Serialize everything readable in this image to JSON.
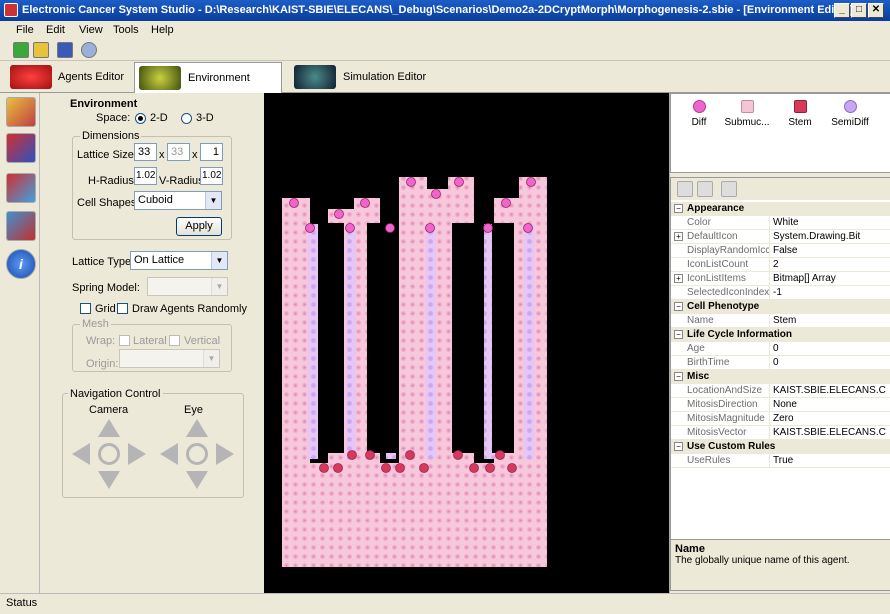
{
  "window": {
    "title": "Electronic Cancer System Studio - D:\\Research\\KAIST-SBIE\\ELECANS\\_Debug\\Scenarios\\Demo2a-2DCryptMorph\\Morphogenesis-2.sbie - [Environment Editor]"
  },
  "menu": [
    "File",
    "Edit",
    "View",
    "Tools",
    "Help"
  ],
  "tabs": [
    {
      "label": "Agents Editor"
    },
    {
      "label": "Environment Editor"
    },
    {
      "label": "Simulation Editor"
    }
  ],
  "environment": {
    "title": "Environment",
    "space_label": "Space:",
    "space_2d": "2-D",
    "space_3d": "3-D",
    "space_selected": "2-D",
    "dimensions_title": "Dimensions",
    "lattice_size_label": "Lattice Size:",
    "lattice_x": "33",
    "lattice_y": "33",
    "lattice_z": "1",
    "x_sep": "x",
    "hradius_label": "H-Radius:",
    "hradius": "1.02",
    "vradius_label": "V-Radius:",
    "vradius": "1.02",
    "cell_shapes_label": "Cell Shapes:",
    "cell_shape": "Cuboid",
    "apply_label": "Apply",
    "lattice_type_label": "Lattice Type:",
    "lattice_type": "On Lattice",
    "spring_model_label": "Spring Model:",
    "grid_label": "Grid",
    "draw_random_label": "Draw Agents Randomly",
    "mesh_title": "Mesh",
    "wrap_label": "Wrap:",
    "lateral_label": "Lateral",
    "vertical_label": "Vertical",
    "origin_label": "Origin:"
  },
  "navigation": {
    "title": "Navigation Control",
    "camera_label": "Camera",
    "eye_label": "Eye"
  },
  "agent_icons": [
    {
      "label": "Diff",
      "color": "#ee66cc"
    },
    {
      "label": "Submuc...",
      "color": "#f4c6d4"
    },
    {
      "label": "Stem",
      "color": "#d63a5a"
    },
    {
      "label": "SemiDiff",
      "color": "#c6a8f0"
    }
  ],
  "properties": [
    {
      "cat": "Appearance"
    },
    {
      "name": "Color",
      "value": "White"
    },
    {
      "name": "DefaultIcon",
      "value": "System.Drawing.Bit",
      "expand": true
    },
    {
      "name": "DisplayRandomIcc",
      "value": "False"
    },
    {
      "name": "IconListCount",
      "value": "2"
    },
    {
      "name": "IconListItems",
      "value": "Bitmap[] Array",
      "expand": true
    },
    {
      "name": "SelectedIconIndex",
      "value": "-1"
    },
    {
      "cat": "Cell Phenotype"
    },
    {
      "name": "Name",
      "value": "Stem"
    },
    {
      "cat": "Life Cycle Information"
    },
    {
      "name": "Age",
      "value": "0"
    },
    {
      "name": "BirthTime",
      "value": "0"
    },
    {
      "cat": "Misc"
    },
    {
      "name": "LocationAndSize",
      "value": "KAIST.SBIE.ELECANS.C"
    },
    {
      "name": "MitosisDirection",
      "value": "None"
    },
    {
      "name": "MitosisMagnitude",
      "value": "Zero"
    },
    {
      "name": "MitosisVector",
      "value": "KAIST.SBIE.ELECANS.C"
    },
    {
      "cat": "Use Custom Rules"
    },
    {
      "name": "UseRules",
      "value": "True"
    }
  ],
  "help": {
    "title": "Name",
    "text": "The globally unique name of this agent."
  },
  "status": "Status"
}
